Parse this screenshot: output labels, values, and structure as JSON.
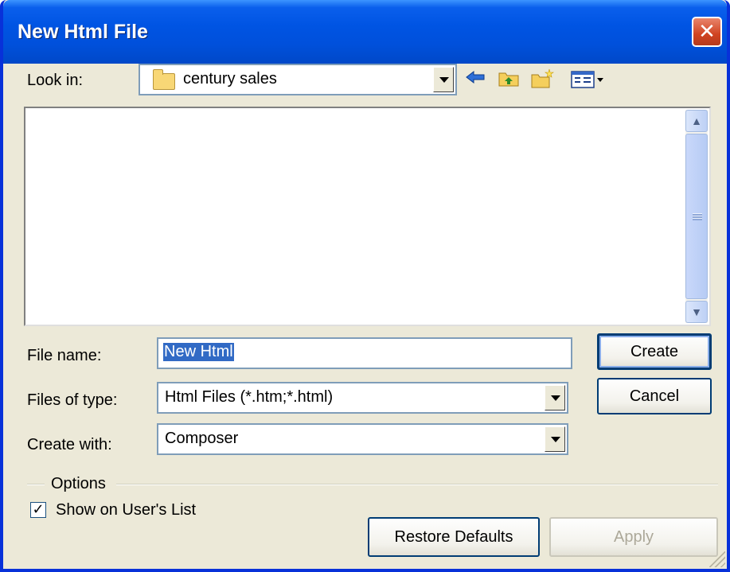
{
  "dialog": {
    "title": "New Html File",
    "close_glyph": "✕"
  },
  "look_in": {
    "label": "Look in:",
    "value": "century sales",
    "icons": [
      "folder-icon",
      "back-arrow-icon",
      "up-one-level-icon",
      "new-folder-icon",
      "view-menu-icon"
    ]
  },
  "file_list": {
    "items": []
  },
  "file_name": {
    "label": "File name:",
    "value": "New Html"
  },
  "files_of_type": {
    "label": "Files of type:",
    "value": "Html Files (*.htm;*.html)"
  },
  "create_with": {
    "label": "Create with:",
    "value": "Composer"
  },
  "buttons": {
    "create": "Create",
    "cancel": "Cancel",
    "restore_defaults": "Restore Defaults",
    "apply": "Apply"
  },
  "options": {
    "legend": "Options",
    "show_on_users_list": {
      "label": "Show on User's List",
      "checked": true
    }
  },
  "colors": {
    "title_bar": "#0054e3",
    "window_bg": "#ece9d8",
    "selection": "#316ac5",
    "close_button": "#d04321"
  }
}
